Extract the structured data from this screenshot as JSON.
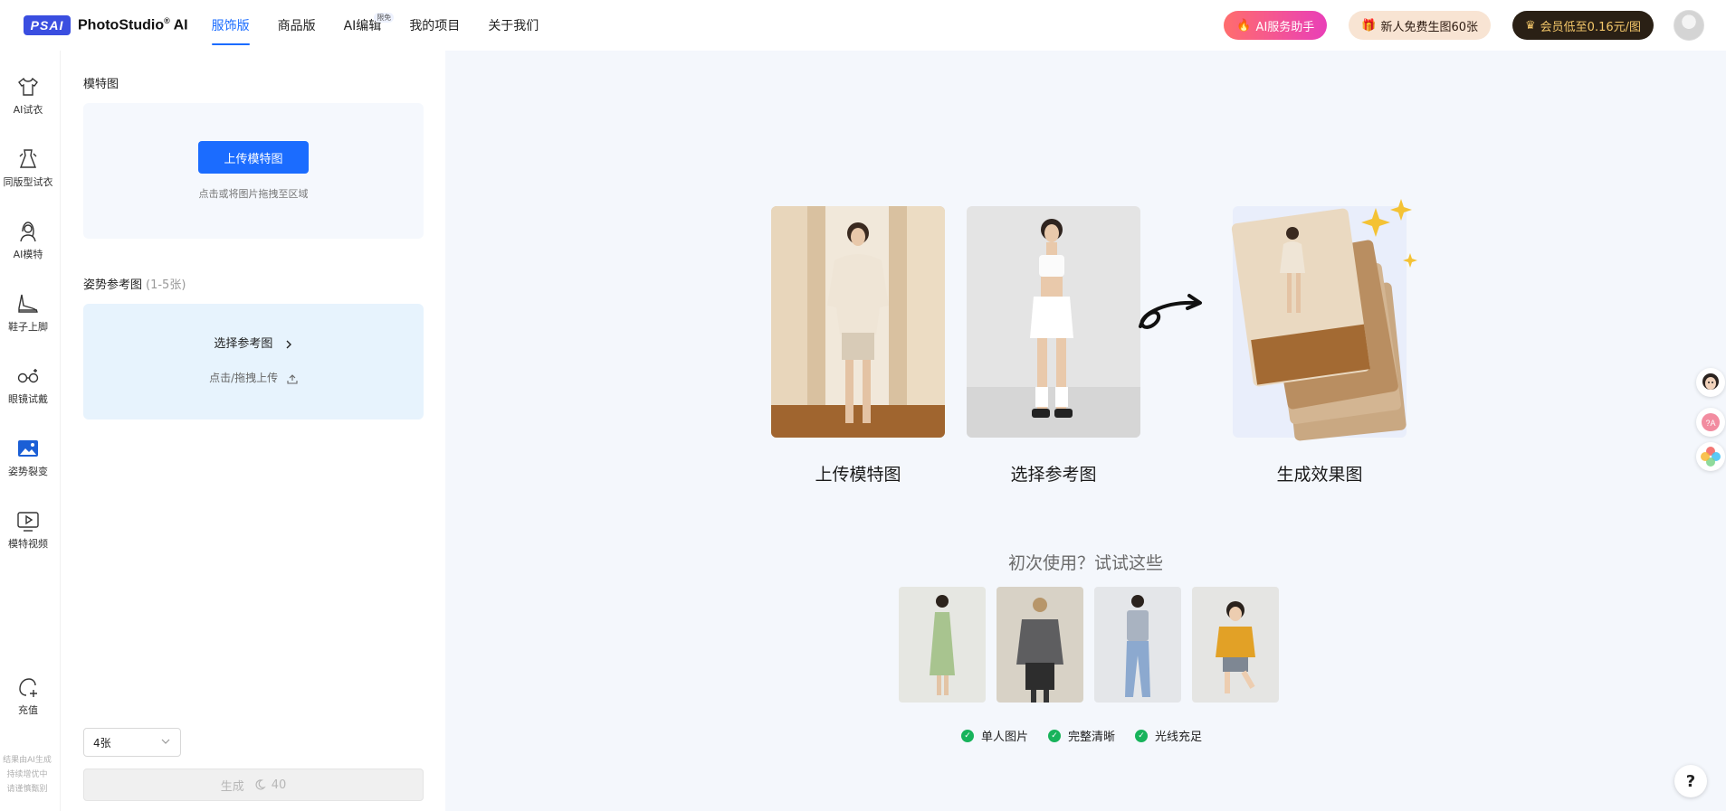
{
  "app": {
    "logo_mark": "PSAI",
    "name": "PhotoStudio",
    "name_suffix": " AI",
    "reg": "®"
  },
  "nav": {
    "items": [
      {
        "label": "服饰版",
        "active": true
      },
      {
        "label": "商品版"
      },
      {
        "label": "AI编辑",
        "badge": "限免"
      },
      {
        "label": "我的项目"
      },
      {
        "label": "关于我们"
      }
    ]
  },
  "header": {
    "ai_helper": "AI服务助手",
    "free_gift": "新人免费生图60张",
    "vip": "会员低至0.16元/图"
  },
  "toolbar": {
    "items": [
      {
        "label": "AI试衣",
        "icon": "shirt-icon"
      },
      {
        "label": "同版型试衣",
        "icon": "dress-icon"
      },
      {
        "label": "AI模特",
        "icon": "model-icon"
      },
      {
        "label": "鞋子上脚",
        "icon": "shoe-icon"
      },
      {
        "label": "眼镜试戴",
        "icon": "glasses-icon"
      },
      {
        "label": "姿势裂变",
        "icon": "image-icon"
      },
      {
        "label": "模特视频",
        "icon": "video-icon"
      }
    ],
    "recharge": "充值",
    "note": [
      "结果由AI生成",
      "持续增优中",
      "请谨慎甄别"
    ]
  },
  "panel": {
    "model_title": "模特图",
    "upload_button": "上传模特图",
    "upload_hint": "点击或将图片拖拽至区域",
    "pose_title": "姿势参考图",
    "pose_sub": "(1-5张)",
    "pose_select": "选择参考图",
    "pose_upload": "点击/拖拽上传",
    "count_select": "4张",
    "generate": "生成",
    "generate_cost": "40"
  },
  "main": {
    "step1": "上传模特图",
    "step2": "选择参考图",
    "step3": "生成效果图",
    "try_title": "初次使用？试试这些",
    "checks": [
      "单人图片",
      "完整清晰",
      "光线充足"
    ]
  },
  "colors": {
    "accent": "#1b6cff",
    "panel_bg": "#f4f7fc",
    "check_green": "#18b35b"
  }
}
